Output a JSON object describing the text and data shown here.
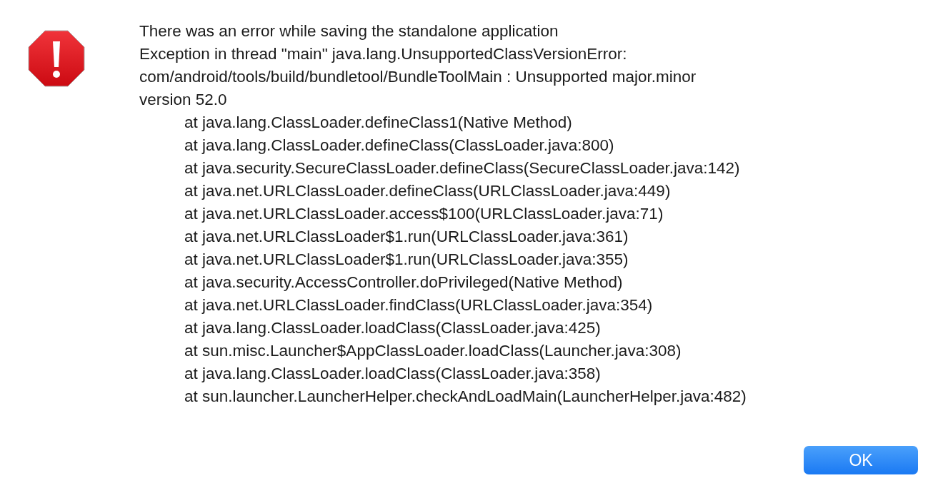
{
  "dialog": {
    "message_lines": [
      "There was an error while saving the standalone application",
      "Exception in thread \"main\" java.lang.UnsupportedClassVersionError:",
      "com/android/tools/build/bundletool/BundleToolMain : Unsupported major.minor",
      "version 52.0"
    ],
    "stack_trace": [
      "at java.lang.ClassLoader.defineClass1(Native Method)",
      "at java.lang.ClassLoader.defineClass(ClassLoader.java:800)",
      "at java.security.SecureClassLoader.defineClass(SecureClassLoader.java:142)",
      "at java.net.URLClassLoader.defineClass(URLClassLoader.java:449)",
      "at java.net.URLClassLoader.access$100(URLClassLoader.java:71)",
      "at java.net.URLClassLoader$1.run(URLClassLoader.java:361)",
      "at java.net.URLClassLoader$1.run(URLClassLoader.java:355)",
      "at java.security.AccessController.doPrivileged(Native Method)",
      "at java.net.URLClassLoader.findClass(URLClassLoader.java:354)",
      "at java.lang.ClassLoader.loadClass(ClassLoader.java:425)",
      "at sun.misc.Launcher$AppClassLoader.loadClass(Launcher.java:308)",
      "at java.lang.ClassLoader.loadClass(ClassLoader.java:358)",
      "at sun.launcher.LauncherHelper.checkAndLoadMain(LauncherHelper.java:482)"
    ],
    "buttons": [
      "OK"
    ]
  }
}
